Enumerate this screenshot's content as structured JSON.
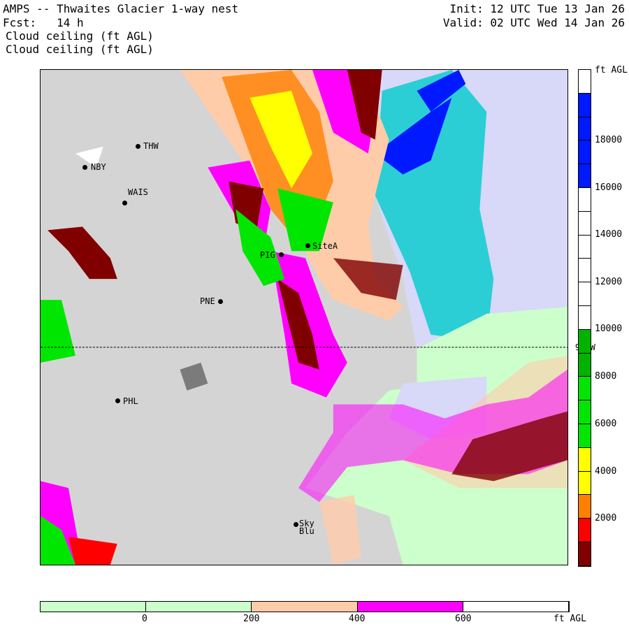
{
  "header": {
    "title": "AMPS -- Thwaites Glacier 1-way nest",
    "fcst": "Fcst:   14 h",
    "field1": "Cloud ceiling (ft AGL)",
    "field2": "Cloud ceiling (ft AGL)",
    "init": "Init: 12 UTC Tue 13 Jan 26",
    "valid": "Valid: 02 UTC Wed 14 Jan 26"
  },
  "stations": [
    {
      "name": "THW"
    },
    {
      "name": "NBY"
    },
    {
      "name": "WAIS"
    },
    {
      "name": "SiteA"
    },
    {
      "name": "PIG"
    },
    {
      "name": "PNE"
    },
    {
      "name": "PHL"
    },
    {
      "name": "Sky Blu"
    }
  ],
  "meridian_label": "90 W",
  "colorbar": {
    "unit": "ft AGL",
    "labels": [
      "18000",
      "16000",
      "14000",
      "12000",
      "10000",
      "8000",
      "6000",
      "4000",
      "2000"
    ],
    "colors": [
      "#ffffff",
      "#0019ff",
      "#0019ff",
      "#0019ff",
      "#0019ff",
      "#ffffff",
      "#ffffff",
      "#ffffff",
      "#ffffff",
      "#ffffff",
      "#ffffff",
      "#00b300",
      "#00b300",
      "#00e600",
      "#00e600",
      "#00e600",
      "#ffff00",
      "#ffff00",
      "#ff8000",
      "#ff0000",
      "#800000"
    ]
  },
  "bottom_bar": {
    "unit": "ft AGL",
    "labels": [
      "0",
      "200",
      "400",
      "600"
    ],
    "colors": [
      "#ccffcc",
      "#ccffcc",
      "#ffccaa",
      "#ff00ff",
      "#ffffff"
    ]
  }
}
